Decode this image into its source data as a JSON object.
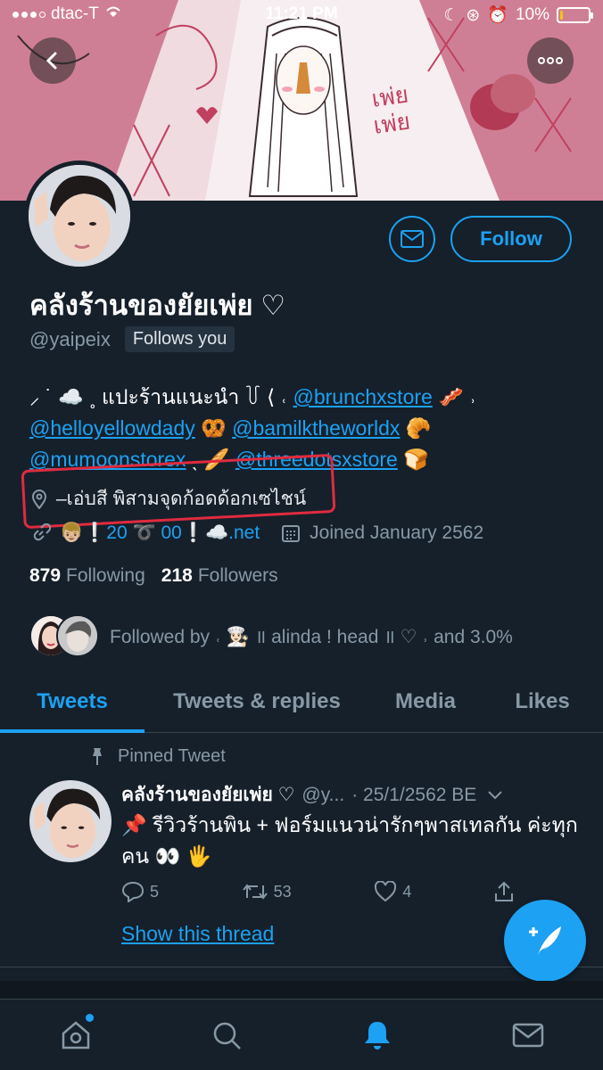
{
  "status_bar": {
    "carrier": "dtac-T",
    "time": "11:21 PM",
    "battery_text": "10%",
    "battery_level": 0.1
  },
  "profile": {
    "display_name": "คลังร้านของยัยเพ่ย ♡",
    "handle": "@yaipeix",
    "follows_you": "Follows you",
    "follow_label": "Follow",
    "bio_parts": {
      "p1": "⸝ ˙ ☁️ ˳ แปะร้านแนะนำ ꒦ ⟨ ˓ ",
      "l1": "@brunchxstore",
      "p2": " 🥓 ˒",
      "l2": "@helloyellowdady",
      "p3": " 🥨 ",
      "l3": "@bamilktheworldx",
      "p4": " 🥐",
      "l4": "@mumoonstorex",
      "p5": " ˎ 🥖 ",
      "l5": "@threedotsxstore",
      "p6": " 🍞"
    },
    "location": "–เอ่บสี พิสามจุดก้อดด้อกเซไชน์",
    "website": "👦🏼❕20 ➰ 00❕☁️.net",
    "joined": "Joined January 2562",
    "following_count": "879",
    "following_label": "Following",
    "followers_count": "218",
    "followers_label": "Followers",
    "followed_by": "Followed by ˓ 👩🏻‍🍳 ॥ alinda ! head ॥ ♡ ˒ and 3.0%"
  },
  "tabs": [
    "Tweets",
    "Tweets & replies",
    "Media",
    "Likes"
  ],
  "pinned_tweet": {
    "pinned_label": "Pinned Tweet",
    "name": "คลังร้านของยัยเพ่ย ♡",
    "handle": "@y...",
    "date": "· 25/1/2562 BE",
    "text": "📌 รีวิวร้านพิน + ฟอร์มแนวน่ารักๆพาสเทลกัน ค่ะทุกคน 👀 🖐",
    "replies": "5",
    "retweets": "53",
    "likes": "4",
    "show_thread": "Show this thread"
  },
  "colors": {
    "accent": "#1da1f2",
    "background": "#15202b",
    "highlight": "#e02b3f"
  }
}
